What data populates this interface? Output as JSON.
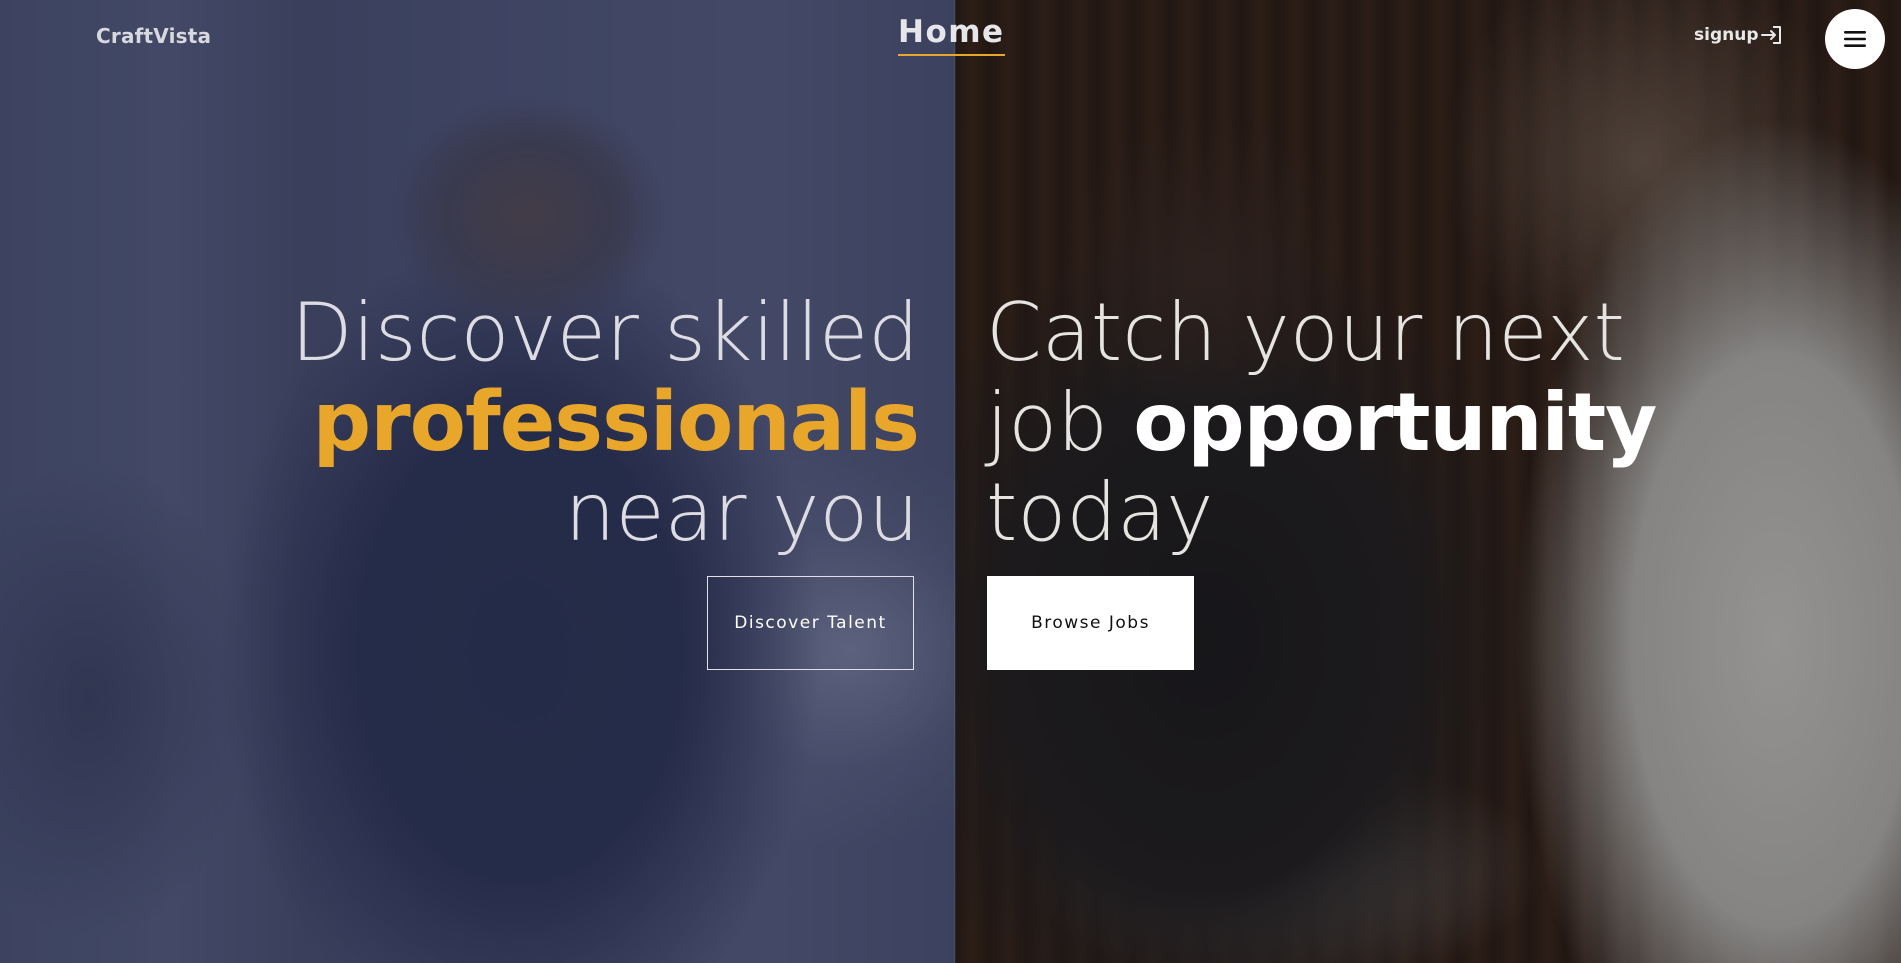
{
  "header": {
    "brand": "CraftVista",
    "nav_home": "Home",
    "signup": "signup",
    "signup_icon": "login-arrow-icon",
    "menu_icon": "hamburger-menu-icon"
  },
  "hero_left": {
    "line1": "Discover skilled",
    "line2": "professionals",
    "line3": "near you",
    "button": "Discover Talent"
  },
  "hero_right": {
    "line1": "Catch your next",
    "line2_plain": "job ",
    "line2_bold": "opportunity",
    "line3": "today",
    "button": "Browse Jobs"
  },
  "colors": {
    "accent": "#e8a62a",
    "left_overlay": "#262c4e",
    "button_light": "#ffffff"
  }
}
